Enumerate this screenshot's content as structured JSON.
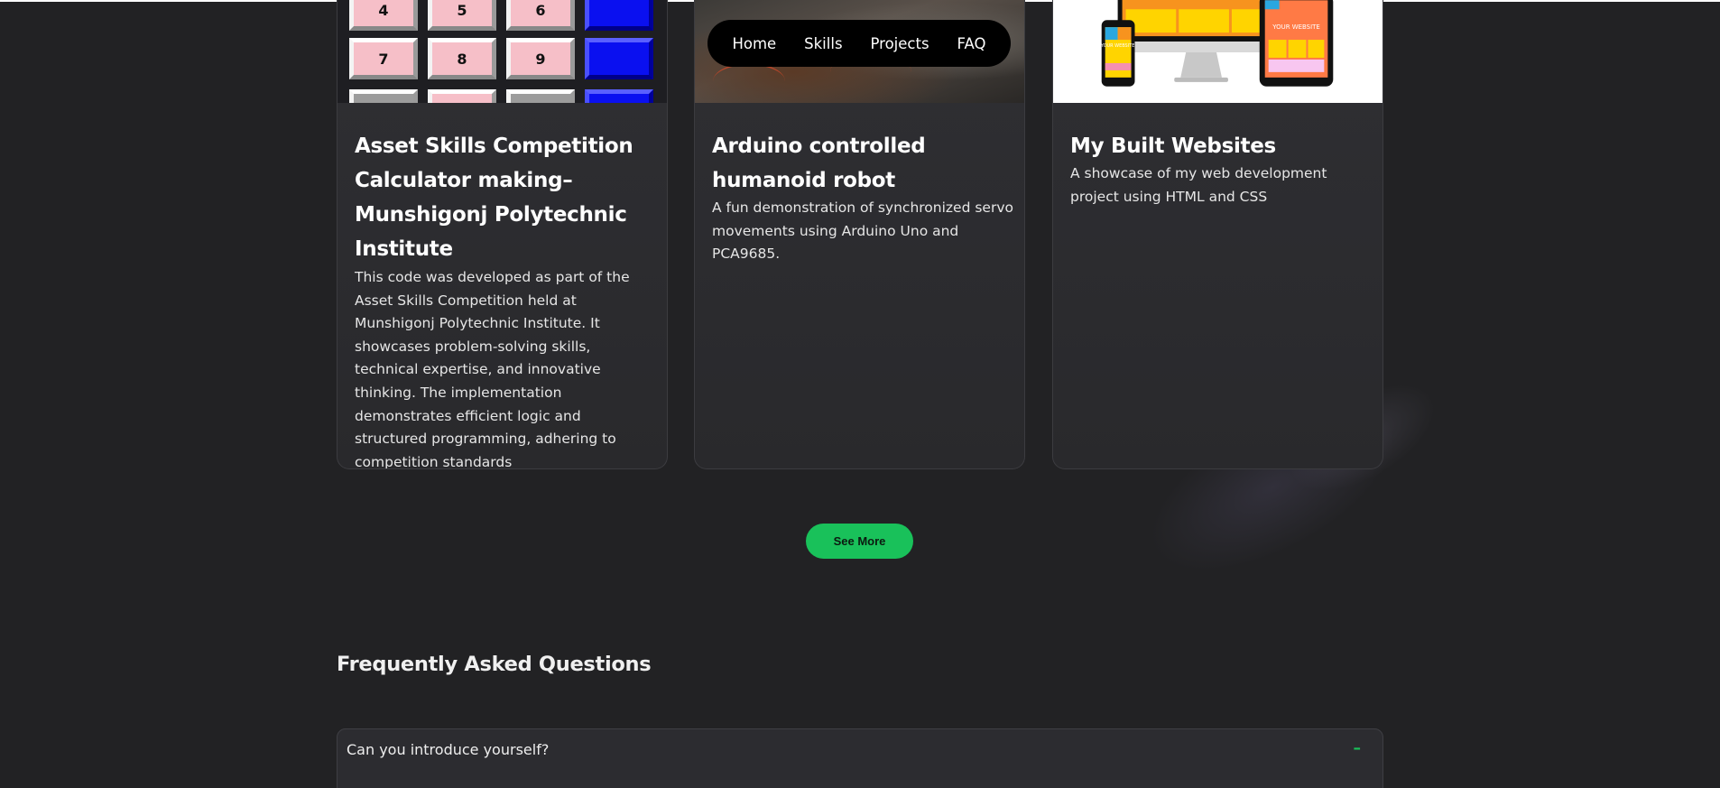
{
  "navbar": {
    "items": [
      {
        "label": "Home"
      },
      {
        "label": "Skills"
      },
      {
        "label": "Projects"
      },
      {
        "label": "FAQ"
      }
    ]
  },
  "projects": [
    {
      "title": "Asset Skills Competition Calculator making–Munshigonj Polytechnic Institute",
      "description": "This code was developed as part of the Asset Skills Competition held at Munshigonj Polytechnic Institute. It showcases problem-solving skills, technical expertise, and innovative thinking. The implementation demonstrates efficient logic and structured programming, adhering to competition standards",
      "image_keys": [
        "4",
        "5",
        "6",
        "7",
        "8",
        "9"
      ]
    },
    {
      "title": "Arduino controlled humanoid robot",
      "description": "A fun demonstration of synchronized servo movements using Arduino Uno and PCA9685."
    },
    {
      "title": "My Built Websites",
      "description": "A showcase of my web development project using HTML and CSS",
      "image_labels": [
        "YOUR WEBSITE",
        "YOUR WEBSITE"
      ]
    }
  ],
  "see_more_label": "See More",
  "faq": {
    "heading": "Frequently Asked Questions",
    "items": [
      {
        "question": "Can you introduce yourself?",
        "toggle": "–"
      }
    ]
  },
  "colors": {
    "background": "#222224",
    "accent": "#19c15a",
    "card": "#2f2f33",
    "navbar": "#000000"
  }
}
